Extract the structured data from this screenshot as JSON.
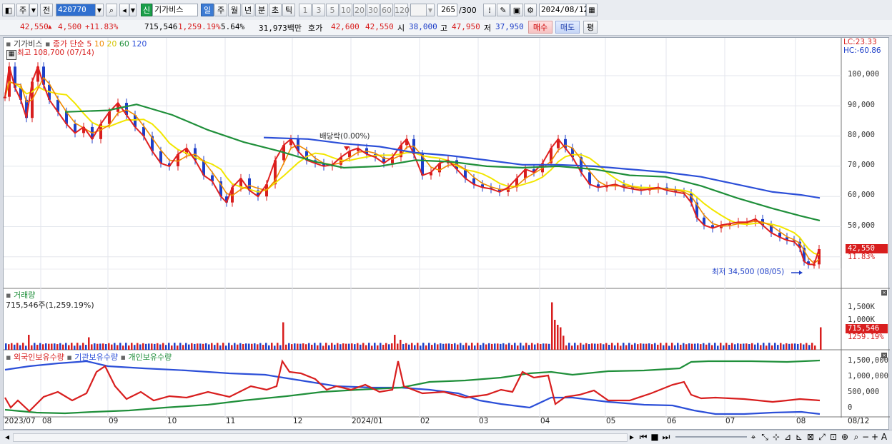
{
  "toolbar": {
    "market": "주",
    "prev_label": "전",
    "code": "420770",
    "badge": "신",
    "name": "기가비스",
    "period_tabs": [
      "일",
      "주",
      "월",
      "년",
      "분",
      "초",
      "틱"
    ],
    "period_selected": "일",
    "intervals": [
      "1",
      "3",
      "5",
      "10",
      "20",
      "30",
      "60",
      "120"
    ],
    "count": "265",
    "count_total": "/300",
    "date": "2024/08/12"
  },
  "quote": {
    "price": "42,550",
    "arrow": "▲",
    "change": "4,500",
    "change_pct": "+11.83%",
    "volume": "715,546",
    "volume_pct": "1,259.19%",
    "turnover_pct": "5.64%",
    "amount": "31,973백만",
    "bid_label": "호가",
    "bid": "42,600",
    "ask": "42,550",
    "open_label": "시",
    "open": "38,000",
    "high_label": "고",
    "high": "47,950",
    "low_label": "저",
    "low": "37,950",
    "buy_label": "매수",
    "sell_label": "매도",
    "eval_label": "평"
  },
  "price_panel": {
    "legend_name": "기가비스",
    "legend_ma": "종가 단순",
    "ma_periods": [
      "5",
      "10",
      "20",
      "60",
      "120"
    ],
    "ma_colors": [
      "#e02020",
      "#f08a00",
      "#f2e600",
      "#1f8f3a",
      "#2c4fd8"
    ],
    "high_note": "최고 108,700 (07/14)",
    "low_note": "최저 34,500 (08/05)",
    "dividend_note": "배당락(0.00%)",
    "lc": "LC:23.33",
    "hc": "HC:-60.86",
    "current_price": "42,550",
    "current_pct": "11.83%",
    "y_ticks": [
      "100,000",
      "90,000",
      "80,000",
      "70,000",
      "60,000",
      "50,000"
    ]
  },
  "volume_panel": {
    "title": "거래량",
    "value": "715,546주(1,259.19%)",
    "y_ticks": [
      "1,500K",
      "1,000K"
    ],
    "current": "715,546",
    "current_pct": "1259.19%"
  },
  "holding_panel": {
    "series": [
      "외국인보유수량",
      "기관보유수량",
      "개인보유수량"
    ],
    "series_colors": [
      "#d81e1e",
      "#2c4fd8",
      "#1f8f3a"
    ],
    "y_ticks": [
      "1,500,000",
      "1,000,000",
      "500,000",
      "0"
    ]
  },
  "x_axis": [
    "2023/07",
    "08",
    "09",
    "10",
    "11",
    "12",
    "2024/01",
    "02",
    "03",
    "04",
    "05",
    "06",
    "07",
    "08"
  ],
  "x_axis_right": "08/12",
  "chart_data": {
    "type": "line",
    "title": "기가비스",
    "x": [
      "2023/07",
      "08",
      "09",
      "10",
      "11",
      "12",
      "2024/01",
      "02",
      "03",
      "04",
      "05",
      "06",
      "07",
      "08"
    ],
    "series": [
      {
        "name": "종가",
        "values": [
          95000,
          85000,
          85000,
          72000,
          62000,
          78000,
          72000,
          68000,
          64000,
          75000,
          63000,
          60000,
          51000,
          42550
        ]
      },
      {
        "name": "120",
        "values": [
          null,
          null,
          null,
          null,
          null,
          79500,
          78500,
          74000,
          71000,
          69500,
          68000,
          66000,
          62500,
          59500
        ]
      },
      {
        "name": "60",
        "values": [
          null,
          null,
          88000,
          84000,
          77000,
          71000,
          69500,
          71000,
          70000,
          70000,
          68000,
          62000,
          56000,
          52000
        ]
      }
    ],
    "ylim": [
      30000,
      112000
    ]
  }
}
